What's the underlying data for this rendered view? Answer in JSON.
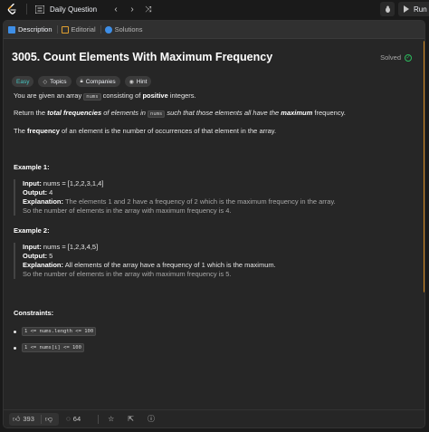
{
  "nav": {
    "title": "Daily Question",
    "run_label": "Run"
  },
  "tabs": [
    {
      "label": "Description",
      "active": true
    },
    {
      "label": "Editorial",
      "active": false
    },
    {
      "label": "Solutions",
      "active": false
    }
  ],
  "problem": {
    "title": "3005. Count Elements With Maximum Frequency",
    "status": "Solved",
    "tags": [
      "Easy",
      "Topics",
      "Companies",
      "Hint"
    ],
    "desc1_pre": "You are given an array",
    "desc1_code": "nums",
    "desc1_mid": "consisting of",
    "desc1_bold": "positive",
    "desc1_post": "integers.",
    "desc2_pre": "Return the",
    "desc2_bold1": "total frequencies",
    "desc2_mid1": "of elements in",
    "desc2_code": "nums",
    "desc2_mid2": "such that those elements all have the",
    "desc2_bold2": "maximum",
    "desc2_post": "frequency.",
    "desc3_pre": "The",
    "desc3_bold": "frequency",
    "desc3_post": "of an element is the number of occurrences of that element in the array."
  },
  "examples": [
    {
      "heading": "Example 1:",
      "input_label": "Input:",
      "input": "nums = [1,2,2,3,1,4]",
      "output_label": "Output:",
      "output": "4",
      "expl_label": "Explanation:",
      "expl1": "The elements 1 and 2 have a frequency of 2 which is the maximum frequency in the array.",
      "expl2": "So the number of elements in the array with maximum frequency is 4."
    },
    {
      "heading": "Example 2:",
      "input_label": "Input:",
      "input": "nums = [1,2,3,4,5]",
      "output_label": "Output:",
      "output": "5",
      "expl_label": "Explanation:",
      "expl1": "All elements of the array have a frequency of 1 which is the maximum.",
      "expl2": "So the number of elements in the array with maximum frequency is 5."
    }
  ],
  "constraints": {
    "heading": "Constraints:",
    "items": [
      "1 <= nums.length <= 100",
      "1 <= nums[i] <= 100"
    ]
  },
  "footer": {
    "likes": "393",
    "comments": "64"
  },
  "colors": {
    "accent_orange": "#d68a1f",
    "easy": "#46c6c2",
    "solved": "#2cbb5d"
  }
}
